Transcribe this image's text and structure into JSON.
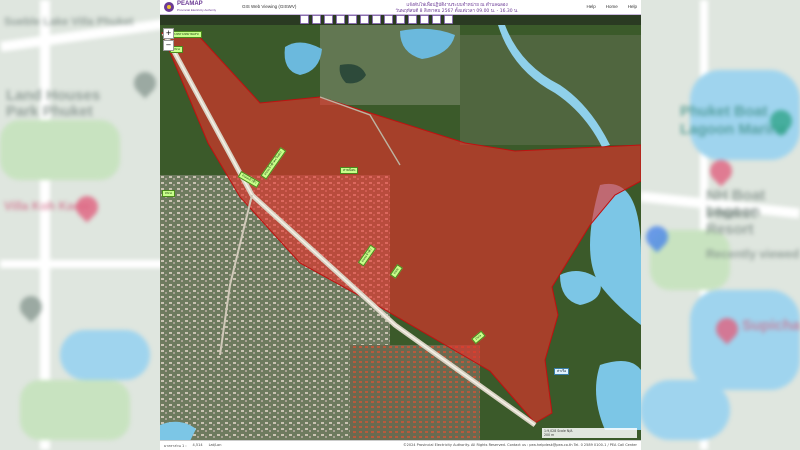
{
  "window": {
    "brand": "PEAMAP",
    "brand_sub": "Provincial Electricity Authority",
    "app_title": "GIS Web Viewing (GISWV)",
    "notice_line1": "แจ้งดับไฟเพื่อปฏิบัติงานระบบจำหน่าย ณ ตำบลฉลอง",
    "notice_line2": "วันพฤหัสบดี 8 สิงหาคม 2567 ตั้งแต่เวลา 09.00 น. - 16.30 น.",
    "nav": [
      "Help",
      "Home",
      "Help"
    ]
  },
  "toolbar": {
    "icons": [
      "layers-icon",
      "measure-icon",
      "identify-icon",
      "search-icon",
      "print-icon",
      "bookmark-icon",
      "basemap-icon",
      "draw-icon",
      "clear-icon",
      "locate-icon",
      "info-icon",
      "share-icon",
      "settings-icon"
    ]
  },
  "map": {
    "zoom_in": "+",
    "zoom_out": "−",
    "outage_area_color": "#e8302a",
    "feeder_labels": [
      "ทางหลวงหมายเลข",
      "ถนน",
      "สายป้อน",
      "ถนนเจ้าฟ้าตะวันตก",
      "ถนนเจ้าฟ้า",
      "ถนนเจ้าฟ้า",
      "ถนน",
      "ถนน",
      "ถนน"
    ],
    "place_label": "ท่าเรือ",
    "scale_line1": "1:9,028  Scale  N/A",
    "scale_line2": "200 m"
  },
  "statusbar": {
    "left_items": [
      "มาตราส่วน 1 :",
      "4,514",
      "Lat/Lon"
    ],
    "right": "©2024 Provincial Electricity Authority. All Rights Reserved. Contact us : pea.helpdesk@pea.co.th Tel. 0 2589 0100-1 / PEA Call Center"
  },
  "background": {
    "labels": [
      "Sueble Lake Villa Phuket",
      "Land Houses",
      "Park Phuket",
      "Phuket Boat",
      "Lagoon Marina",
      "NH Boat Lagoon",
      "Phuket Resort",
      "Recently viewed",
      "Supicha",
      "Villa Koh Kaew"
    ]
  }
}
